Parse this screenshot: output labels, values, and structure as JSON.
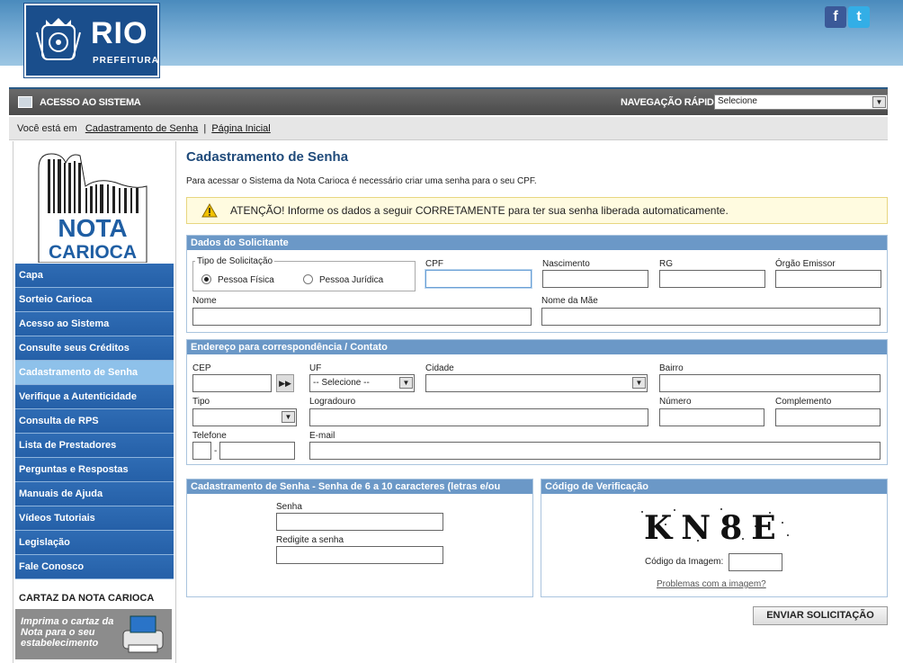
{
  "header": {
    "logo_main": "RIO",
    "logo_sub": "PREFEITURA",
    "social": [
      "facebook-icon",
      "twitter-icon"
    ]
  },
  "accessbar": {
    "title": "ACESSO AO SISTEMA",
    "nav_label": "NAVEGAÇÃO RÁPIDA",
    "nav_select": "Selecione"
  },
  "breadcrumb": {
    "prefix": "Você está em",
    "current": "Cadastramento de Senha",
    "separator": "|",
    "home": "Página Inicial"
  },
  "sidebar": {
    "logo_line1": "NOTA",
    "logo_line2": "CARIOCA",
    "items": [
      {
        "label": "Capa"
      },
      {
        "label": "Sorteio Carioca"
      },
      {
        "label": "Acesso ao Sistema"
      },
      {
        "label": "Consulte seus Créditos"
      },
      {
        "label": "Cadastramento de Senha",
        "active": true
      },
      {
        "label": "Verifique a Autenticidade"
      },
      {
        "label": "Consulta de RPS"
      },
      {
        "label": "Lista de Prestadores"
      },
      {
        "label": "Perguntas e Respostas"
      },
      {
        "label": "Manuais de Ajuda"
      },
      {
        "label": "Vídeos Tutoriais"
      },
      {
        "label": "Legislação"
      },
      {
        "label": "Fale Conosco"
      }
    ],
    "cartaz_title": "CARTAZ DA NOTA CARIOCA",
    "cartaz_text": "Imprima o cartaz da Nota para o seu estabelecimento"
  },
  "main": {
    "title": "Cadastramento de Senha",
    "intro": "Para acessar o Sistema da Nota Carioca é necessário criar uma senha para o seu CPF.",
    "alert": "ATENÇÃO! Informe os dados a seguir CORRETAMENTE para ter sua senha liberada automaticamente.",
    "solicitante": {
      "header": "Dados do Solicitante",
      "tipo_legend": "Tipo de Solicitação",
      "pf": "Pessoa Física",
      "pj": "Pessoa Jurídica",
      "cpf": "CPF",
      "nascimento": "Nascimento",
      "rg": "RG",
      "orgao": "Órgão Emissor",
      "nome": "Nome",
      "mae": "Nome da Mãe"
    },
    "endereco": {
      "header": "Endereço para correspondência / Contato",
      "cep": "CEP",
      "uf": "UF",
      "uf_value": "-- Selecione --",
      "cidade": "Cidade",
      "bairro": "Bairro",
      "tipo": "Tipo",
      "logradouro": "Logradouro",
      "numero": "Número",
      "complemento": "Complemento",
      "telefone": "Telefone",
      "tel_sep": "-",
      "email": "E-mail"
    },
    "senha": {
      "header": "Cadastramento de Senha - Senha de 6 a 10 caracteres (letras e/ou",
      "senha": "Senha",
      "redigite": "Redigite a senha"
    },
    "verificacao": {
      "header": "Código de Verificação",
      "captcha": "KN8E",
      "codigo": "Código da Imagem:",
      "problema": "Problemas com a imagem?"
    },
    "submit": "ENVIAR SOLICITAÇÃO"
  }
}
